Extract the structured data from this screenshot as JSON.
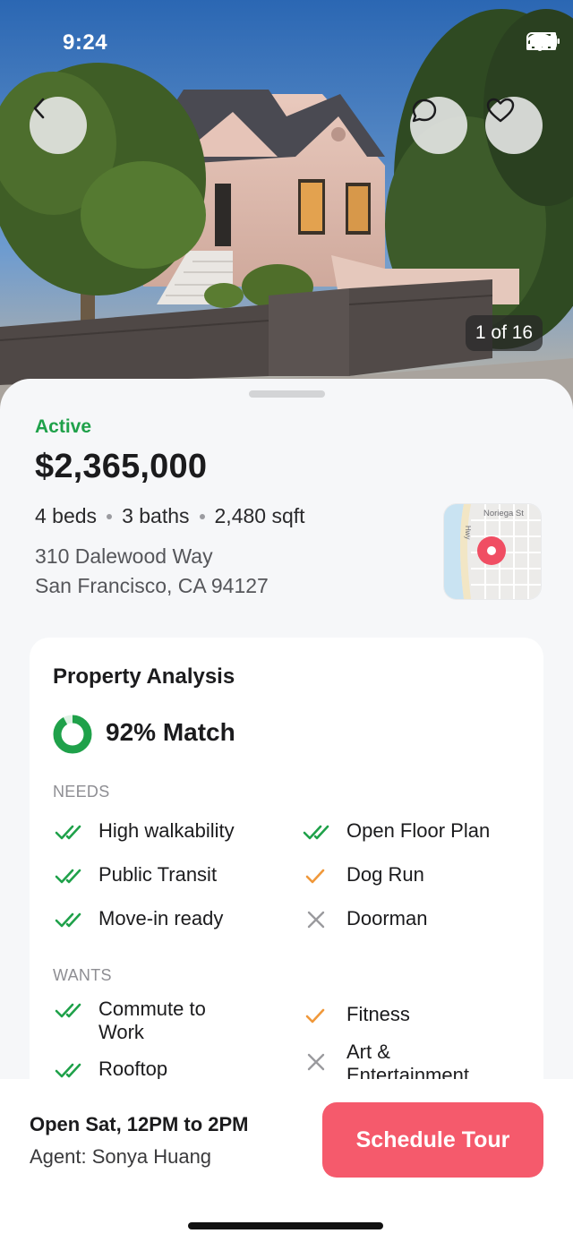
{
  "status_bar": {
    "time": "9:24"
  },
  "hero": {
    "photo_counter": "1 of 16"
  },
  "listing": {
    "status": "Active",
    "price": "$2,365,000",
    "beds": "4 beds",
    "baths": "3 baths",
    "sqft": "2,480 sqft",
    "address_line1": "310 Dalewood Way",
    "address_line2": "San Francisco, CA 94127"
  },
  "map": {
    "street_label": "Noriega St",
    "road_label": "Hwy"
  },
  "analysis": {
    "title": "Property Analysis",
    "match_percent": 92,
    "match_label": "92% Match",
    "needs_label": "NEEDS",
    "wants_label": "WANTS",
    "needs_left": [
      {
        "label": "High walkability",
        "status": "met"
      },
      {
        "label": "Public Transit",
        "status": "met"
      },
      {
        "label": "Move-in ready",
        "status": "met"
      }
    ],
    "needs_right": [
      {
        "label": "Open Floor Plan",
        "status": "met"
      },
      {
        "label": "Dog Run",
        "status": "partial"
      },
      {
        "label": "Doorman",
        "status": "unmet"
      }
    ],
    "wants_left": [
      {
        "label": "Commute to Work",
        "status": "met"
      },
      {
        "label": "Rooftop",
        "status": "met"
      }
    ],
    "wants_right": [
      {
        "label": "Fitness",
        "status": "partial"
      },
      {
        "label": "Art & Entertainment",
        "status": "unmet"
      }
    ]
  },
  "bottom_bar": {
    "open_house": "Open Sat, 12PM to 2PM",
    "agent": "Agent: Sonya Huang",
    "cta_label": "Schedule Tour"
  },
  "colors": {
    "accent_green": "#1fa14a",
    "cta_pink": "#f55a6c",
    "partial_orange": "#f0983a",
    "unmet_gray": "#9a9a9e"
  }
}
